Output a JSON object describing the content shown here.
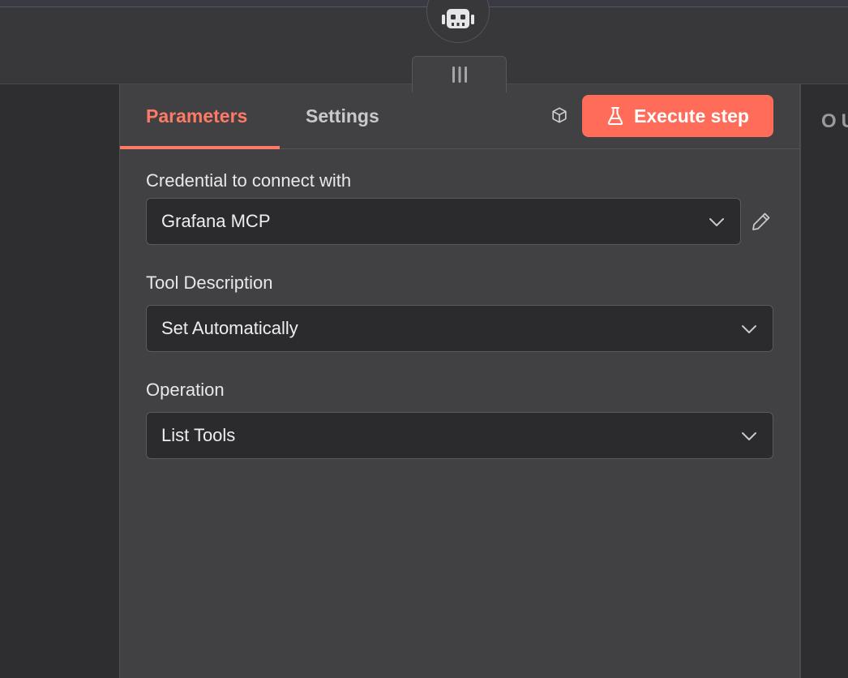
{
  "canvas": {
    "node_icon": "robot-icon",
    "drag_handle_icon": "drag-handle-icon"
  },
  "tabs": [
    {
      "label": "Parameters",
      "active": true
    },
    {
      "label": "Settings",
      "active": false
    }
  ],
  "toolbar": {
    "cube_icon": "cube-icon",
    "execute_label": "Execute step",
    "execute_icon": "flask-icon"
  },
  "fields": {
    "credential": {
      "label": "Credential to connect with",
      "value": "Grafana MCP",
      "edit_icon": "pencil-icon"
    },
    "tool_description": {
      "label": "Tool Description",
      "value": "Set Automatically"
    },
    "operation": {
      "label": "Operation",
      "value": "List Tools"
    }
  },
  "output_panel": {
    "label": "OU"
  },
  "colors": {
    "accent": "#ff6d5a",
    "active_tab": "#ff7a66",
    "panel_bg": "#414143",
    "input_bg": "#2b2b2d"
  }
}
